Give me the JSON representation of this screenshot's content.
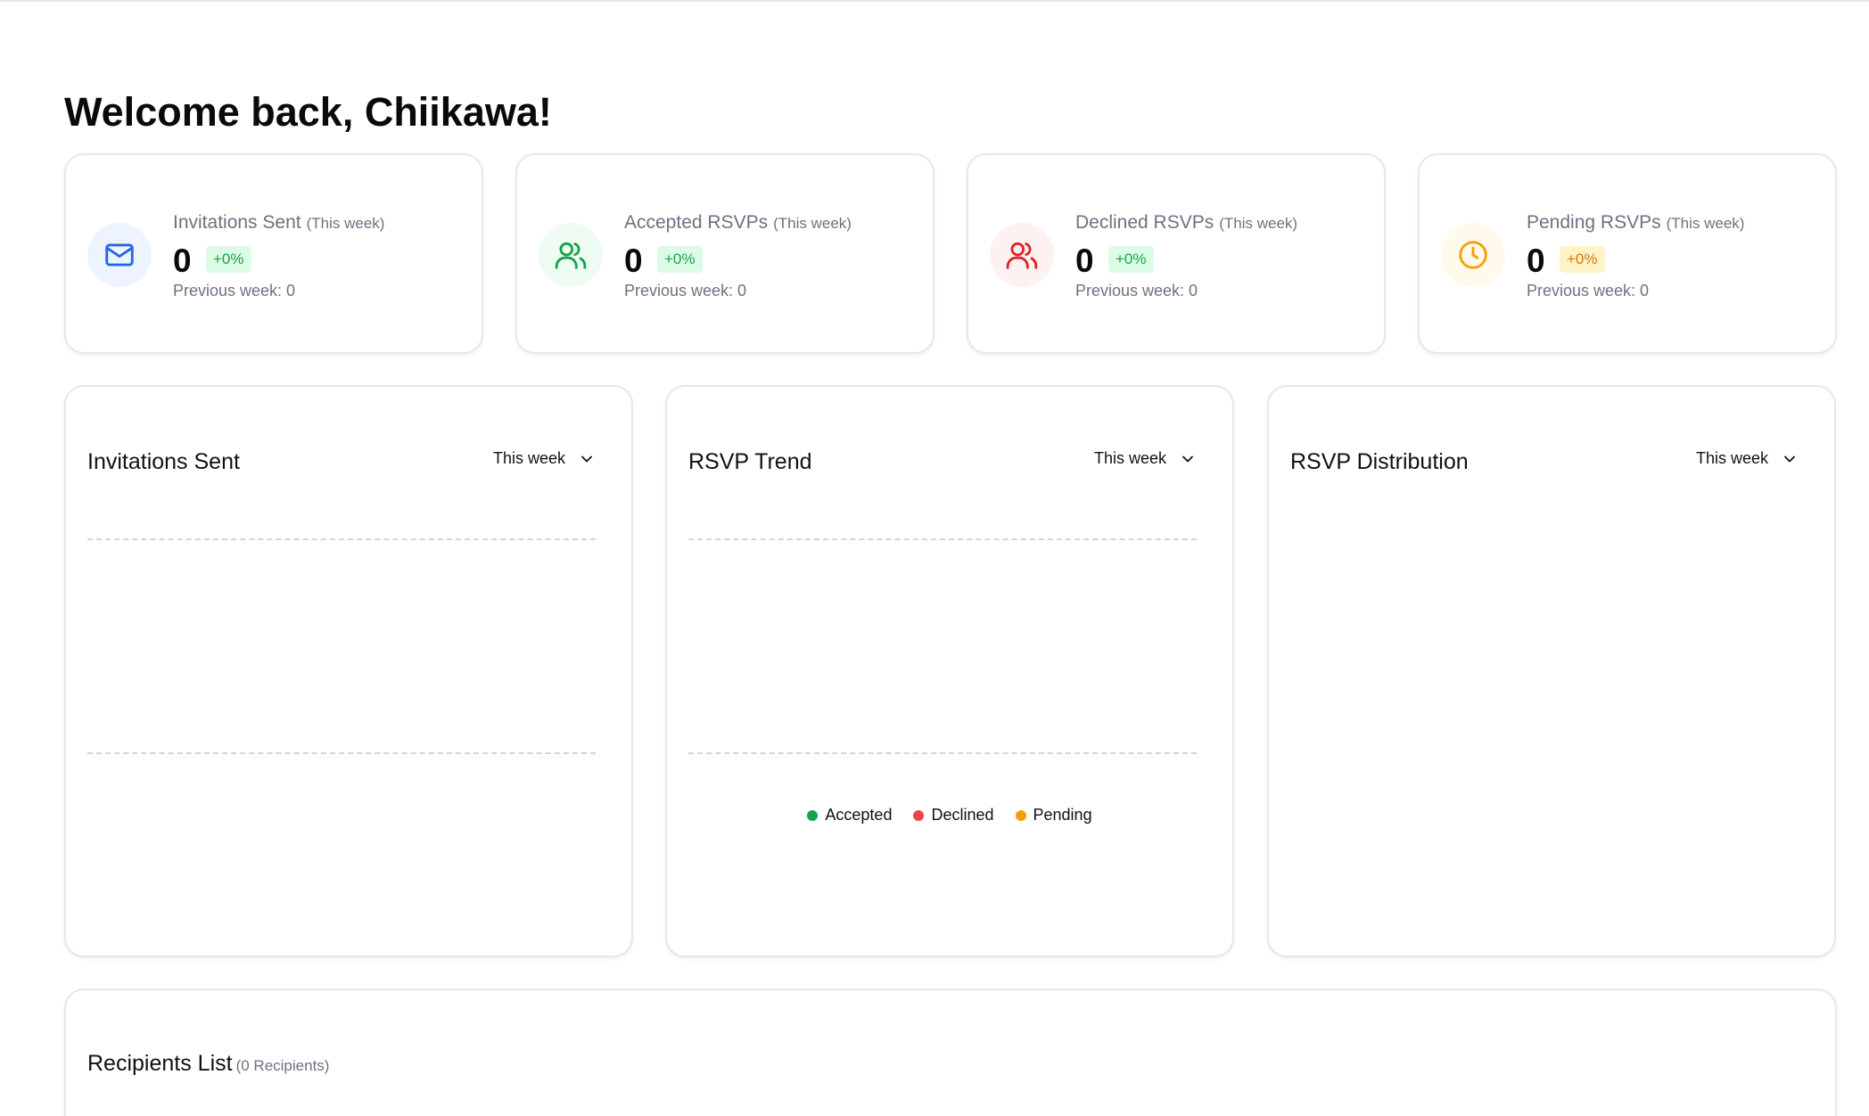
{
  "page": {
    "title": "Welcome back, Chiikawa!"
  },
  "stats": [
    {
      "label": "Invitations Sent",
      "period": "(This week)",
      "value": "0",
      "change": "+0%",
      "previous": "Previous week: 0",
      "icon": "mail-icon",
      "accent": "#2563eb",
      "icon_bg": "#eef4ff",
      "badge_bg": "#dcfce7",
      "badge_color": "#16a34a"
    },
    {
      "label": "Accepted RSVPs",
      "period": "(This week)",
      "value": "0",
      "change": "+0%",
      "previous": "Previous week: 0",
      "icon": "users-icon",
      "accent": "#16a34a",
      "icon_bg": "#effcf3",
      "badge_bg": "#dcfce7",
      "badge_color": "#16a34a"
    },
    {
      "label": "Declined RSVPs",
      "period": "(This week)",
      "value": "0",
      "change": "+0%",
      "previous": "Previous week: 0",
      "icon": "users-icon",
      "accent": "#dc2626",
      "icon_bg": "#fef1f1",
      "badge_bg": "#dcfce7",
      "badge_color": "#16a34a"
    },
    {
      "label": "Pending RSVPs",
      "period": "(This week)",
      "value": "0",
      "change": "+0%",
      "previous": "Previous week: 0",
      "icon": "clock-icon",
      "accent": "#f59e0b",
      "icon_bg": "#fffaeb",
      "badge_bg": "#fef3c7",
      "badge_color": "#d97706"
    }
  ],
  "charts": {
    "invitations": {
      "title": "Invitations Sent",
      "range": "This week"
    },
    "trend": {
      "title": "RSVP Trend",
      "range": "This week",
      "legend": [
        {
          "label": "Accepted",
          "color": "#16a34a"
        },
        {
          "label": "Declined",
          "color": "#ef4444"
        },
        {
          "label": "Pending",
          "color": "#f59e0b"
        }
      ]
    },
    "distribution": {
      "title": "RSVP Distribution",
      "range": "This week"
    }
  },
  "recipients": {
    "title": "Recipients List",
    "count": "(0 Recipients)"
  }
}
